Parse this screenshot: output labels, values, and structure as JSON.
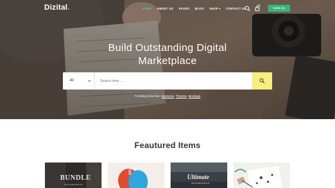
{
  "brand": {
    "name": "Dizital",
    "dot": "."
  },
  "nav": {
    "items": [
      {
        "label": "HOME",
        "active": true
      },
      {
        "label": "ABOUT US",
        "active": false
      },
      {
        "label": "PAGES",
        "active": false
      },
      {
        "label": "BLOG",
        "active": false
      },
      {
        "label": "SHOP",
        "active": false
      },
      {
        "label": "CONTACT US",
        "active": false
      }
    ],
    "signin_label": "SIGN IN"
  },
  "hero": {
    "headline_line1": "Build Outstanding Digital",
    "headline_line2": "Marketplace"
  },
  "search": {
    "category_selected": "All",
    "placeholder": "Search here.....",
    "trending_prefix": "Trending Searches: ",
    "trending_links": [
      "Business",
      "Themes",
      "Mockups"
    ]
  },
  "featured": {
    "title": "Feautured Items",
    "cards": [
      {
        "label": "BUNDLE",
        "sublabel": "INFOGRAPHICS"
      },
      {
        "label": "",
        "sublabel": ""
      },
      {
        "label": "Ultimate",
        "sublabel": "INFOGRAPHICS"
      },
      {
        "label": "",
        "sublabel": ""
      }
    ]
  },
  "colors": {
    "accent_green": "#3fd28a",
    "button_green": "#38b67a",
    "search_button_yellow": "#f7ef7d"
  }
}
